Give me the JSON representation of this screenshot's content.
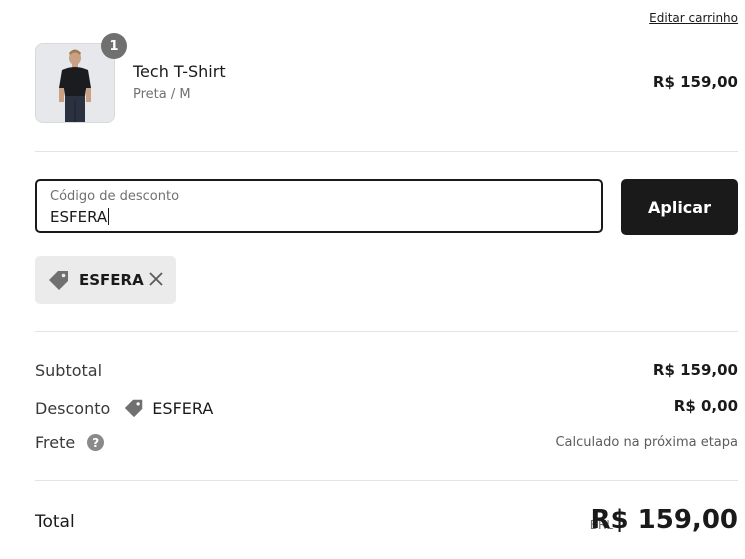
{
  "cart": {
    "edit_link": "Editar carrinho",
    "item": {
      "quantity": "1",
      "name": "Tech T-Shirt",
      "variant": "Preta / M",
      "price": "R$ 159,00"
    }
  },
  "discount": {
    "field_label": "Código de desconto",
    "field_value": "ESFERA",
    "apply_label": "Aplicar",
    "applied_code": "ESFERA"
  },
  "summary": {
    "subtotal_label": "Subtotal",
    "subtotal_value": "R$ 159,00",
    "discount_label": "Desconto",
    "discount_code": "ESFERA",
    "discount_value": "R$ 0,00",
    "shipping_label": "Frete",
    "shipping_note": "Calculado na próxima etapa",
    "total_label": "Total",
    "currency": "BRL",
    "total_value": "R$ 159,00"
  },
  "icons": {
    "tag": "tag-icon",
    "close": "close-icon",
    "help": "help-circle-icon"
  },
  "colors": {
    "primary": "#1a1a1a",
    "chip_bg": "#ebebeb",
    "badge": "#707070"
  }
}
